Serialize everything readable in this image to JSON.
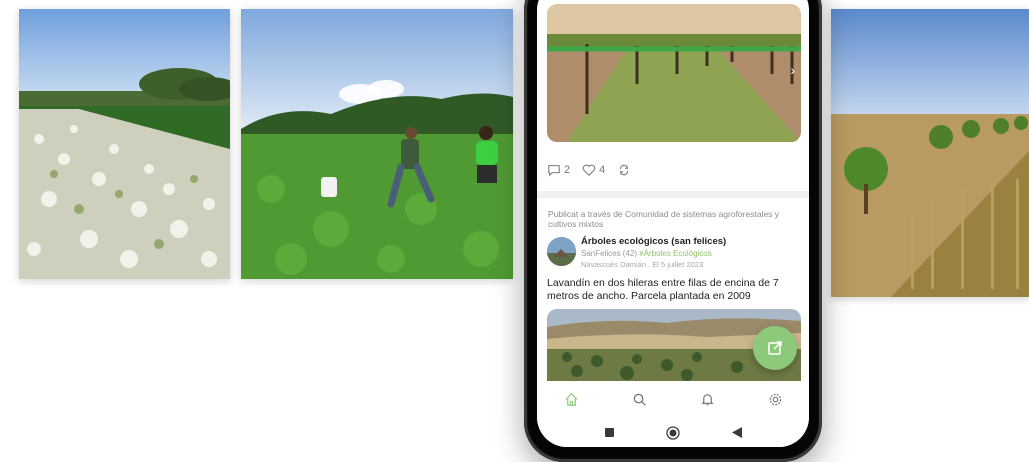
{
  "post": {
    "comments_count": "2",
    "likes_count": "4",
    "published_via": "Publicat a través de Comunidad de sistemas agroforestales y cultivos mixtos",
    "author_name": "Árboles ecológicos (san felices)",
    "author_handle": "SanFelices (42)",
    "author_tag": "#Árboles Ecológicos",
    "date_line": "Navascués Damián . El 5 juillet 2023",
    "text": "Lavandín en dos hileras entre filas de encina de 7 metros de ancho. Parcela plantada en 2009"
  },
  "nav": {
    "items": [
      "home-icon",
      "search-icon",
      "bell-icon",
      "gear-icon"
    ],
    "active": "home-icon"
  },
  "colors": {
    "accent": "#8cc97a",
    "tag": "#8fbf6a",
    "meta": "#9a9a9a"
  }
}
